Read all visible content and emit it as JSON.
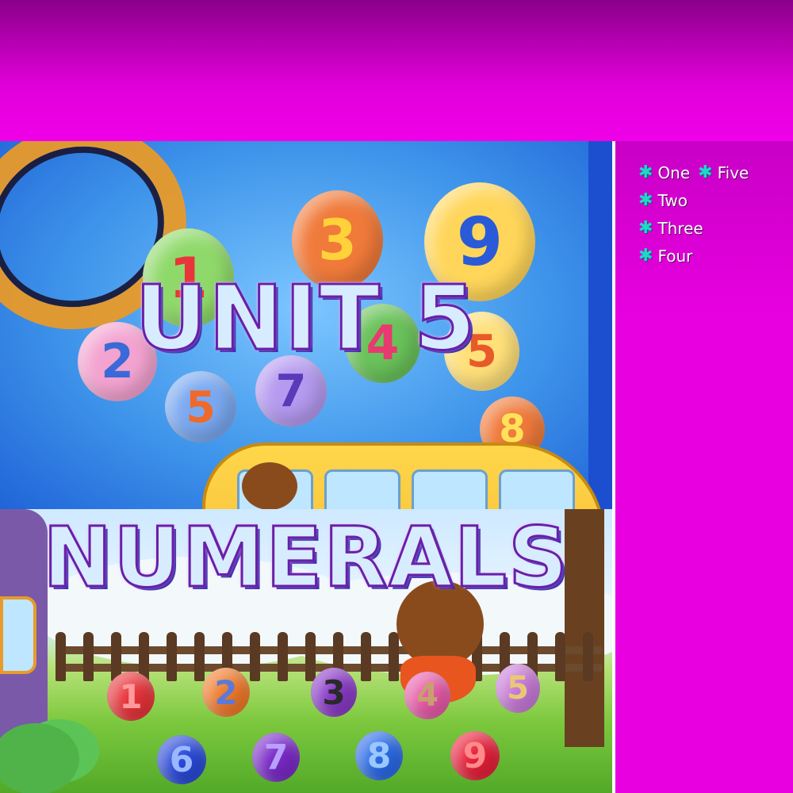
{
  "title": {
    "line1": "UNIT 5",
    "line2": "NUMERALS"
  },
  "numbers_list": [
    [
      "One",
      "Five"
    ],
    [
      "Two"
    ],
    [
      "Three"
    ],
    [
      "Four"
    ]
  ],
  "upper_balloons": [
    "1",
    "3",
    "9",
    "2",
    "4",
    "5",
    "5",
    "7",
    "8"
  ],
  "lower_balloons_row1": [
    "1",
    "2",
    "3",
    "4",
    "5"
  ],
  "lower_balloons_row2": [
    "6",
    "7",
    "8",
    "9"
  ],
  "colors": {
    "background": "#e800e0",
    "title_fill": "#d8ecff",
    "title_outline": "#6a1fa8",
    "bullet": "#1fd6c8"
  }
}
